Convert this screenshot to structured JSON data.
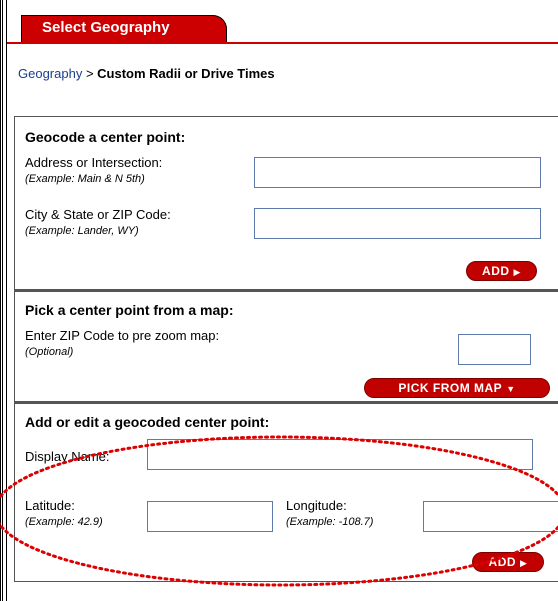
{
  "header": {
    "tab_label": "Select Geography"
  },
  "breadcrumb": {
    "root": "Geography",
    "separator": ">",
    "current": "Custom Radii or Drive Times"
  },
  "geocode": {
    "title": "Geocode a center point:",
    "address_label": "Address or Intersection:",
    "address_example": "(Example: Main & N 5th)",
    "address_value": "",
    "city_label": "City & State or ZIP Code:",
    "city_example": "(Example: Lander, WY)",
    "city_value": "",
    "add_label": "ADD"
  },
  "pick": {
    "title": "Pick a center point from a map:",
    "zip_label": "Enter ZIP Code to pre zoom map:",
    "zip_note": "(Optional)",
    "zip_value": "",
    "button_label": "PICK FROM MAP"
  },
  "edit": {
    "title": "Add or edit a geocoded center point:",
    "display_label": "Display Name:",
    "display_value": "",
    "lat_label": "Latitude:",
    "lat_example": "(Example: 42.9)",
    "lat_value": "",
    "lon_label": "Longitude:",
    "lon_example": "(Example: -108.7)",
    "lon_value": "",
    "add_label": "ADD"
  },
  "colors": {
    "accent": "#cc0000",
    "link": "#1a3f8f",
    "annotation": "#dd0000"
  }
}
